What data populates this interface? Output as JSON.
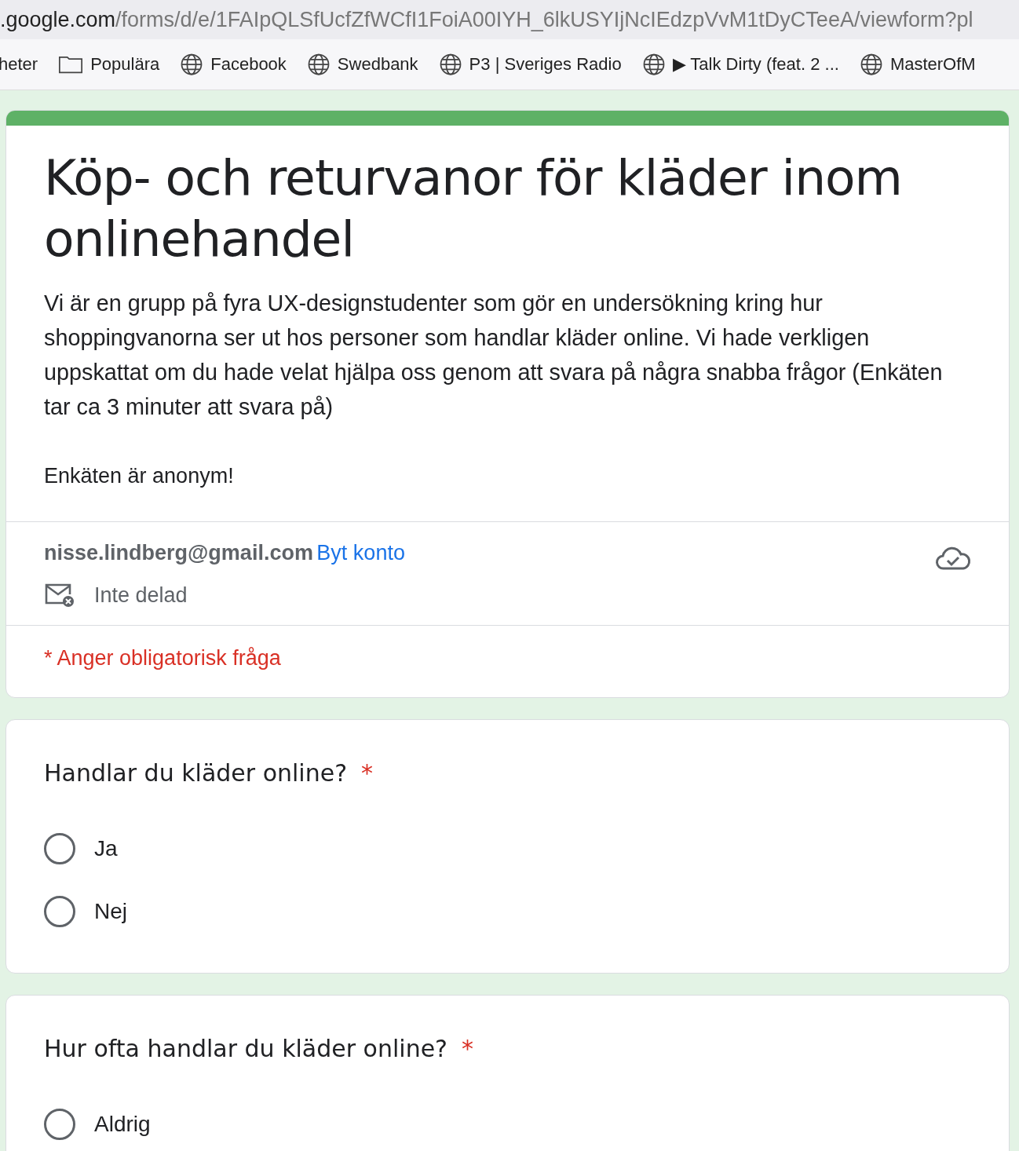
{
  "browser": {
    "url_host": ".google.com",
    "url_path": "/forms/d/e/1FAIpQLSfUcfZfWCfI1FoiA00IYH_6lkUSYIjNcIEdzpVvM1tDyCTeeA/viewform?pl",
    "bookmarks": [
      {
        "kind": "text",
        "label": "heter"
      },
      {
        "kind": "folder",
        "label": "Populära"
      },
      {
        "kind": "globe",
        "label": "Facebook"
      },
      {
        "kind": "globe",
        "label": "Swedbank"
      },
      {
        "kind": "globe",
        "label": "P3 | Sveriges Radio"
      },
      {
        "kind": "globe",
        "label": "▶ Talk Dirty (feat. 2 ..."
      },
      {
        "kind": "globe",
        "label": "MasterOfM"
      }
    ]
  },
  "form": {
    "title": "Köp- och returvanor för kläder inom onlinehandel",
    "description": "Vi är en grupp på fyra UX-designstudenter som gör en undersökning kring hur shoppingvanorna ser ut hos personer som handlar kläder online. Vi hade verkligen uppskattat om du hade velat hjälpa oss genom att svara på några snabba frågor (Enkäten tar ca 3 minuter att svara på)",
    "note": "Enkäten är anonym!",
    "account": "nisse.lindberg@gmail.com",
    "switch_account": "Byt konto",
    "sharing": "Inte delad",
    "required_note": "* Anger obligatorisk fråga"
  },
  "questions": [
    {
      "title": "Handlar du kläder online?",
      "required": true,
      "required_mark": "*",
      "options": [
        {
          "label": "Ja",
          "selected": false
        },
        {
          "label": "Nej",
          "selected": false
        }
      ]
    },
    {
      "title": "Hur ofta handlar du kläder online?",
      "required": true,
      "required_mark": "*",
      "options": [
        {
          "label": "Aldrig",
          "selected": false
        }
      ]
    }
  ]
}
